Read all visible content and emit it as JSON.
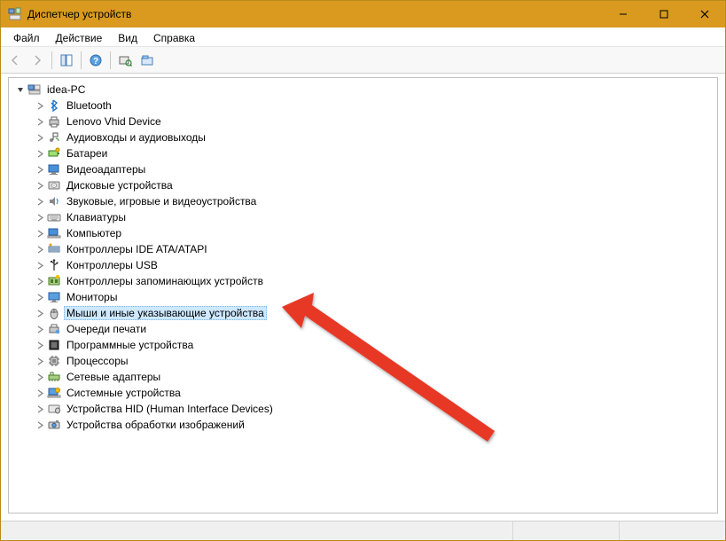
{
  "window": {
    "title": "Диспетчер устройств"
  },
  "menu": {
    "file": "Файл",
    "action": "Действие",
    "view": "Вид",
    "help": "Справка"
  },
  "tree": {
    "root": "idea-PC",
    "items": [
      {
        "label": "Bluetooth",
        "icon": "bluetooth"
      },
      {
        "label": "Lenovo Vhid Device",
        "icon": "printer"
      },
      {
        "label": "Аудиовходы и аудиовыходы",
        "icon": "audio-jack"
      },
      {
        "label": "Батареи",
        "icon": "battery"
      },
      {
        "label": "Видеоадаптеры",
        "icon": "display-adapter"
      },
      {
        "label": "Дисковые устройства",
        "icon": "disk"
      },
      {
        "label": "Звуковые, игровые и видеоустройства",
        "icon": "sound"
      },
      {
        "label": "Клавиатуры",
        "icon": "keyboard"
      },
      {
        "label": "Компьютер",
        "icon": "computer"
      },
      {
        "label": "Контроллеры IDE ATA/ATAPI",
        "icon": "ide"
      },
      {
        "label": "Контроллеры USB",
        "icon": "usb"
      },
      {
        "label": "Контроллеры запоминающих устройств",
        "icon": "storage-ctrl"
      },
      {
        "label": "Мониторы",
        "icon": "monitor"
      },
      {
        "label": "Мыши и иные указывающие устройства",
        "icon": "mouse",
        "selected": true
      },
      {
        "label": "Очереди печати",
        "icon": "print-queue"
      },
      {
        "label": "Программные устройства",
        "icon": "software-device"
      },
      {
        "label": "Процессоры",
        "icon": "cpu"
      },
      {
        "label": "Сетевые адаптеры",
        "icon": "network"
      },
      {
        "label": "Системные устройства",
        "icon": "system"
      },
      {
        "label": "Устройства HID (Human Interface Devices)",
        "icon": "hid"
      },
      {
        "label": "Устройства обработки изображений",
        "icon": "imaging"
      }
    ]
  },
  "colors": {
    "titlebar": "#d99a1f",
    "selection": "#cde8ff",
    "arrow": "#e73828"
  }
}
